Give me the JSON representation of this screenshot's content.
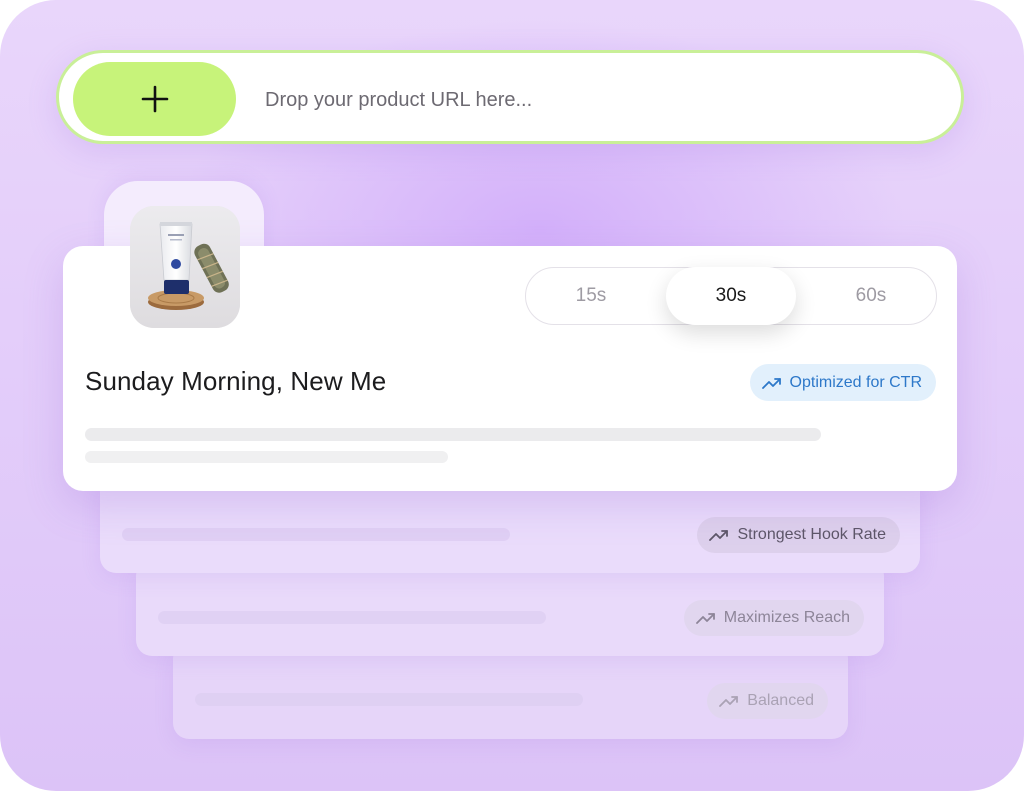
{
  "url_bar": {
    "placeholder": "Drop your product URL here..."
  },
  "icons": {
    "add": "plus-icon",
    "trend": "trending-up-icon"
  },
  "main_card": {
    "title": "Sunday Morning, New Me",
    "badge": "Optimized for CTR",
    "thumbnail": "product-thumbnail",
    "durations": [
      {
        "label": "15s",
        "selected": false
      },
      {
        "label": "30s",
        "selected": true
      },
      {
        "label": "60s",
        "selected": false
      }
    ]
  },
  "variants": [
    {
      "badge": "Strongest Hook Rate"
    },
    {
      "badge": "Maximizes Reach"
    },
    {
      "badge": "Balanced"
    }
  ],
  "colors": {
    "accent_green": "#c7f37a",
    "ctr_blue": "#2d78c9",
    "background_lavender": "#e4cefa"
  }
}
